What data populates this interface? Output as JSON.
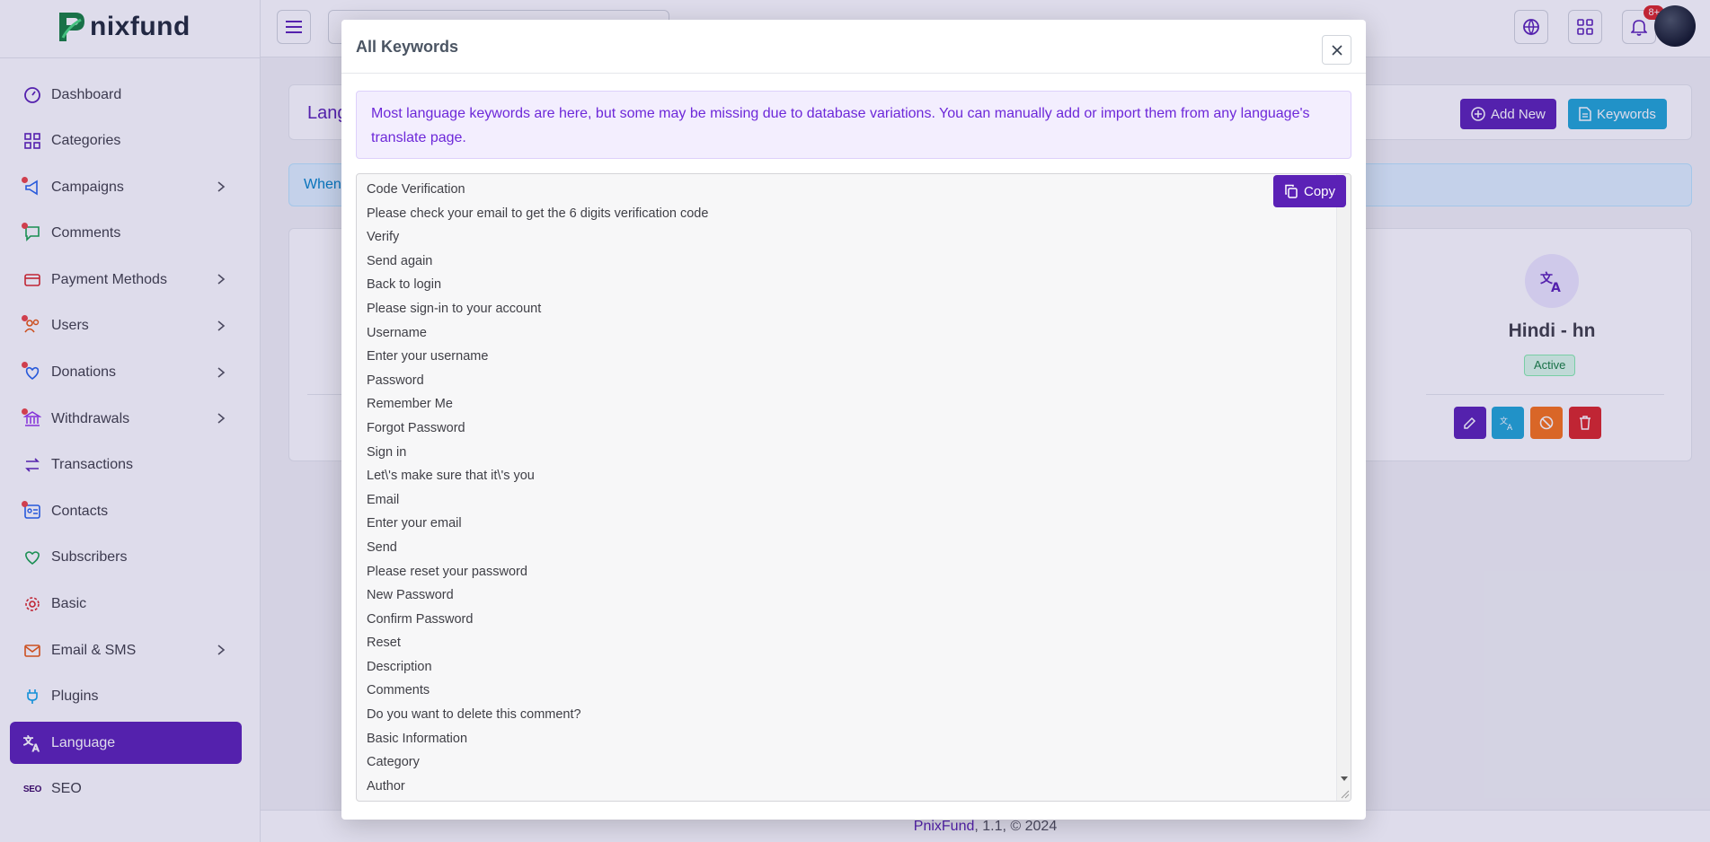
{
  "brand": {
    "name": "nixfund"
  },
  "sidebar": {
    "items": [
      {
        "label": "Dashboard",
        "icon": "gauge-icon",
        "dot": false,
        "chevron": false,
        "active": false
      },
      {
        "label": "Categories",
        "icon": "grid-icon",
        "dot": false,
        "chevron": false,
        "active": false
      },
      {
        "label": "Campaigns",
        "icon": "megaphone-icon",
        "dot": true,
        "chevron": true,
        "active": false
      },
      {
        "label": "Comments",
        "icon": "chat-icon",
        "dot": true,
        "chevron": false,
        "active": false
      },
      {
        "label": "Payment Methods",
        "icon": "card-icon",
        "dot": false,
        "chevron": true,
        "active": false
      },
      {
        "label": "Users",
        "icon": "users-icon",
        "dot": true,
        "chevron": true,
        "active": false
      },
      {
        "label": "Donations",
        "icon": "donation-icon",
        "dot": true,
        "chevron": true,
        "active": false
      },
      {
        "label": "Withdrawals",
        "icon": "bank-icon",
        "dot": true,
        "chevron": true,
        "active": false
      },
      {
        "label": "Transactions",
        "icon": "transfer-icon",
        "dot": false,
        "chevron": false,
        "active": false
      },
      {
        "label": "Contacts",
        "icon": "contact-icon",
        "dot": true,
        "chevron": false,
        "active": false
      },
      {
        "label": "Subscribers",
        "icon": "heart-icon",
        "dot": false,
        "chevron": false,
        "active": false
      },
      {
        "label": "Basic",
        "icon": "gear-icon",
        "dot": false,
        "chevron": false,
        "active": false
      },
      {
        "label": "Email & SMS",
        "icon": "mail-icon",
        "dot": false,
        "chevron": true,
        "active": false
      },
      {
        "label": "Plugins",
        "icon": "plug-icon",
        "dot": false,
        "chevron": false,
        "active": false
      },
      {
        "label": "Language",
        "icon": "translate-icon",
        "dot": false,
        "chevron": false,
        "active": true
      },
      {
        "label": "SEO",
        "icon": "seo-icon",
        "dot": false,
        "chevron": false,
        "active": false
      }
    ]
  },
  "header": {
    "notification_count": "8+"
  },
  "page": {
    "title": "Lang",
    "add_new_label": "Add New",
    "keywords_label": "Keywords",
    "info_text": "When",
    "language": {
      "name": "Hindi - hn",
      "status": "Active"
    }
  },
  "modal": {
    "title": "All Keywords",
    "notice": "Most language keywords are here, but some may be missing due to database variations. You can manually add or import them from any language's translate page.",
    "copy_label": "Copy",
    "keywords": [
      "Code Verification",
      "Please check your email to get the 6 digits verification code",
      "Verify",
      "Send again",
      "Back to login",
      "Please sign-in to your account",
      "Username",
      "Enter your username",
      "Password",
      "Remember Me",
      "Forgot Password",
      "Sign in",
      "Let\\'s make sure that it\\'s you",
      "Email",
      "Enter your email",
      "Send",
      "Please reset your password",
      "New Password",
      "Confirm Password",
      "Reset",
      "Description",
      "Comments",
      "Do you want to delete this comment?",
      "Basic Information",
      "Category",
      "Author"
    ]
  },
  "footer": {
    "brand": "PnixFund",
    "rest": ", 1.1, © 2024"
  },
  "colors": {
    "primary": "#5b21b6",
    "info": "#1ea7d6",
    "danger": "#dc2626",
    "warning": "#f97316",
    "success": "#15803d"
  }
}
